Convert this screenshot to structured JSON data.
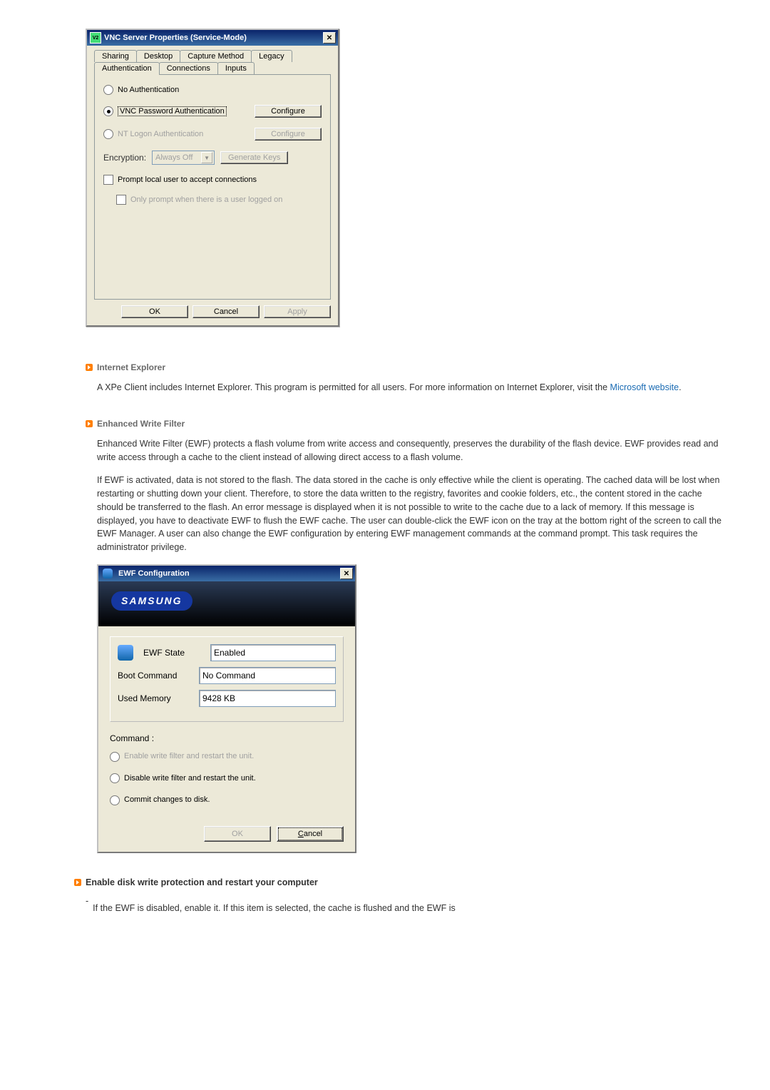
{
  "vnc": {
    "title": "VNC Server Properties (Service-Mode)",
    "icon_text": "V2",
    "tabs_row1": [
      "Sharing",
      "Desktop",
      "Capture Method",
      "Legacy"
    ],
    "tabs_row2": [
      "Authentication",
      "Connections",
      "Inputs"
    ],
    "radio_noauth": "No Authentication",
    "radio_vncpwd": "VNC Password Authentication",
    "radio_ntlogon": "NT Logon Authentication",
    "btn_configure": "Configure",
    "btn_configure_disabled": "Configure",
    "encryption_label": "Encryption:",
    "encryption_value": "Always Off",
    "btn_generate_keys": "Generate Keys",
    "check_prompt": "Prompt local user to accept connections",
    "check_onlyprompt": "Only prompt when there is a user logged on",
    "btn_ok": "OK",
    "btn_cancel": "Cancel",
    "btn_apply": "Apply"
  },
  "sections": {
    "ie": {
      "title": "Internet Explorer",
      "body": "A XPe Client includes Internet Explorer. This program is permitted for all users. For more information on Internet Explorer, visit the ",
      "link_text": "Microsoft website",
      "body_after": "."
    },
    "ewf": {
      "title": "Enhanced Write Filter",
      "p1": "Enhanced Write Filter (EWF) protects a flash volume from write access and consequently, preserves the durability of the flash device. EWF provides read and write access through a cache to the client instead of allowing direct access to a flash volume.",
      "p2": "If EWF is activated, data is not stored to the flash. The data stored in the cache is only effective while the client is operating. The cached data will be lost when restarting or shutting down your client. Therefore, to store the data written to the registry, favorites and cookie folders, etc., the content stored in the cache should be transferred to the flash.  An error message is displayed when it is not possible to write to the cache due to a lack of memory. If this message is displayed, you have to deactivate EWF to flush the EWF cache. The user can double-click the EWF icon on the tray at the bottom right of the screen to call the EWF Manager. A user can also change the EWF configuration by entering EWF management commands at the command prompt. This task requires the administrator privilege."
    },
    "enable": {
      "title": "Enable disk write protection and restart your computer",
      "body": "If the EWF is disabled, enable it. If this item is selected, the cache is flushed and the EWF is"
    }
  },
  "ewf_dialog": {
    "title": "EWF Configuration",
    "logo_text": "SAMSUNG",
    "state_label": "EWF State",
    "state_value": "Enabled",
    "boot_label": "Boot Command",
    "boot_value": "No Command",
    "mem_label": "Used Memory",
    "mem_value": "9428 KB",
    "command_label": "Command :",
    "radio_enable": "Enable write filter and restart the unit.",
    "radio_disable": "Disable write filter and restart the unit.",
    "radio_commit": "Commit changes to disk.",
    "btn_ok": "OK",
    "btn_cancel": "Cancel"
  }
}
